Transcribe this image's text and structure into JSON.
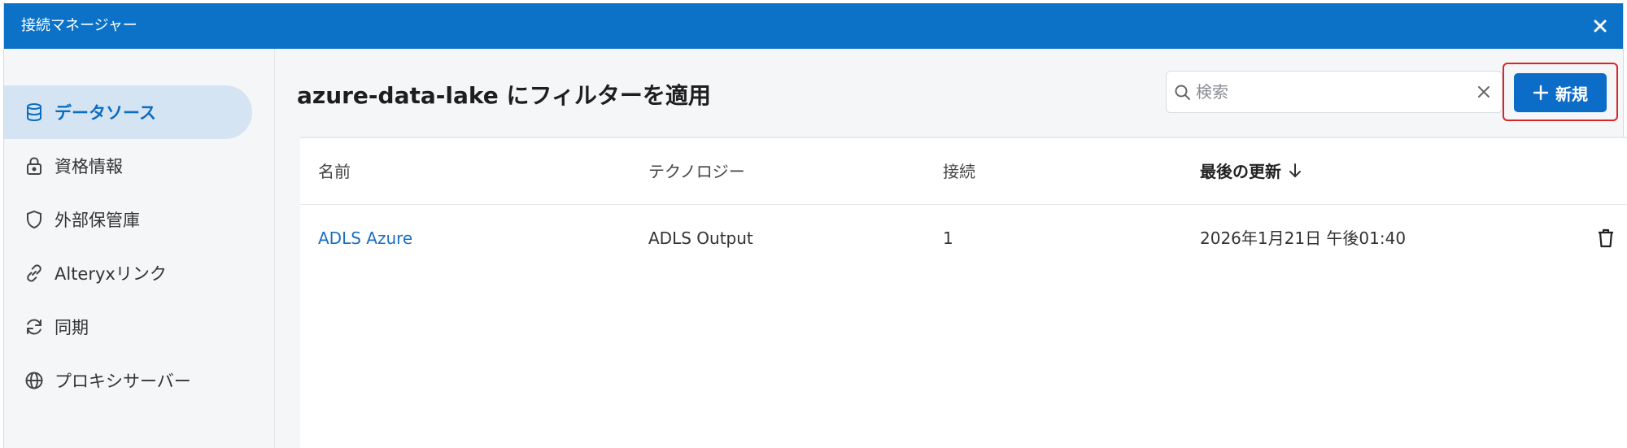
{
  "window": {
    "title": "接続マネージャー"
  },
  "sidebar": {
    "items": [
      {
        "label": "データソース",
        "icon": "database-icon",
        "active": true
      },
      {
        "label": "資格情報",
        "icon": "lock-icon",
        "active": false
      },
      {
        "label": "外部保管庫",
        "icon": "shield-icon",
        "active": false
      },
      {
        "label": "Alteryxリンク",
        "icon": "link-icon",
        "active": false
      },
      {
        "label": "同期",
        "icon": "sync-icon",
        "active": false
      },
      {
        "label": "プロキシサーバー",
        "icon": "globe-icon",
        "active": false
      }
    ]
  },
  "main": {
    "title": "azure-data-lake にフィルターを適用",
    "search": {
      "placeholder": "検索",
      "value": ""
    },
    "new_button": {
      "label": "新規"
    }
  },
  "table": {
    "columns": [
      "名前",
      "テクノロジー",
      "接続",
      "最後の更新"
    ],
    "sorted_column": "最後の更新",
    "sort_direction": "descending",
    "rows": [
      {
        "name": "ADLS Azure",
        "technology": "ADLS Output",
        "connections": "1",
        "updated": "2026年1月21日 午後01:40"
      }
    ]
  },
  "colors": {
    "titlebar": "#0b72c7",
    "accent": "#0b6dc7",
    "highlight": "#d9242a",
    "active_nav_bg": "#d5e4f3",
    "link": "#1a6fc4"
  }
}
